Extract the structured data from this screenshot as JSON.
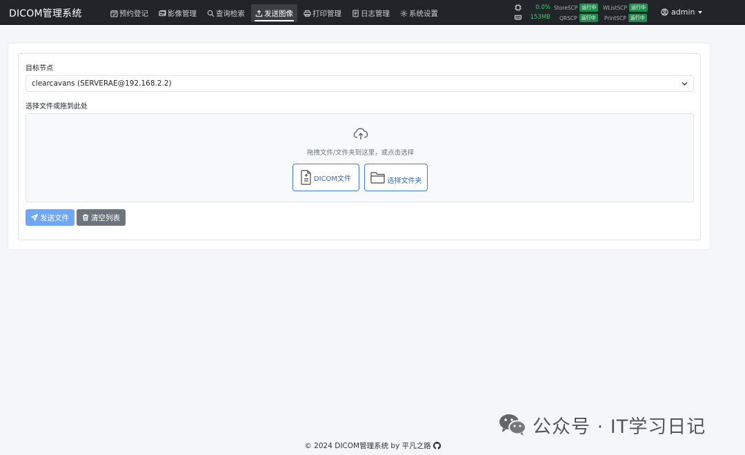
{
  "navbar": {
    "brand": "DICOM管理系统",
    "items": [
      {
        "label": "预约登记",
        "icon": "calendar-check-icon"
      },
      {
        "label": "影像管理",
        "icon": "images-icon"
      },
      {
        "label": "查询检索",
        "icon": "search-icon"
      },
      {
        "label": "发送图像",
        "icon": "upload-icon",
        "active": true
      },
      {
        "label": "打印管理",
        "icon": "printer-icon"
      },
      {
        "label": "日志管理",
        "icon": "journal-icon"
      },
      {
        "label": "系统设置",
        "icon": "gear-icon"
      }
    ],
    "cpu": "0.0%",
    "memory": "153MB",
    "services": [
      {
        "name": "StoreSCP",
        "status": "运行中"
      },
      {
        "name": "WListSCP",
        "status": "运行中"
      },
      {
        "name": "QRSCP",
        "status": "运行中"
      },
      {
        "name": "PrintSCP",
        "status": "运行中"
      }
    ],
    "user": "admin"
  },
  "form": {
    "target_label": "目标节点",
    "target_value": "clearcavans (SERVERAE@192.168.2.2)",
    "file_label": "选择文件或拖到此处",
    "drop_hint": "拖拽文件/文件夹到这里，或点击选择",
    "dicom_button": "DICOM文件",
    "folder_button": "选择文件夹",
    "send_button": "发送文件",
    "clear_button": "清空列表"
  },
  "watermark": "公众号 · IT学习日记",
  "footer": "© 2024 DICOM管理系统 by 平凡之路",
  "colors": {
    "navbar_bg": "#212529",
    "primary": "#6ea8f5",
    "secondary": "#6c757d",
    "status_green": "#1f8a4c",
    "stat_green": "#2fd06a",
    "outline_blue": "#3d7bd9"
  }
}
